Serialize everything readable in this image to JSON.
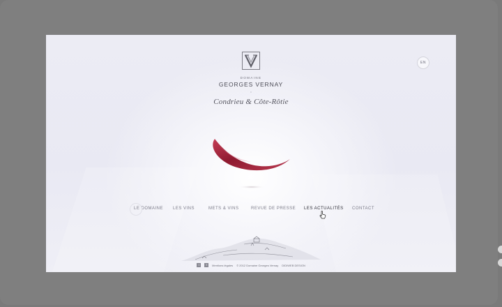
{
  "brand": {
    "small": "DOMAINE",
    "name": "GEORGES VERNAY",
    "dot": "•",
    "subtitle": "Condrieu & Côte-Rôtie"
  },
  "lang": "EN",
  "nav": {
    "items": [
      "LE DOMAINE",
      "LES VINS",
      "METS & VINS",
      "REVUE DE PRESSE",
      "LES ACTUALITÉS",
      "CONTACT"
    ],
    "active_index": 4
  },
  "footer": {
    "legal": "Mentions légales",
    "copyright": "© 2012 Domaine Georges Vernay",
    "credit": "DIDIWEB DESIGN"
  },
  "colors": {
    "frame": "#7f7f7f",
    "background": "#ececf4",
    "text": "#4b4b55",
    "petal": "#9a1f35"
  },
  "icons": {
    "logo": "monogram-v-icon",
    "twitter": "twitter-icon",
    "facebook": "facebook-icon",
    "cursor": "hand-pointer-icon"
  }
}
